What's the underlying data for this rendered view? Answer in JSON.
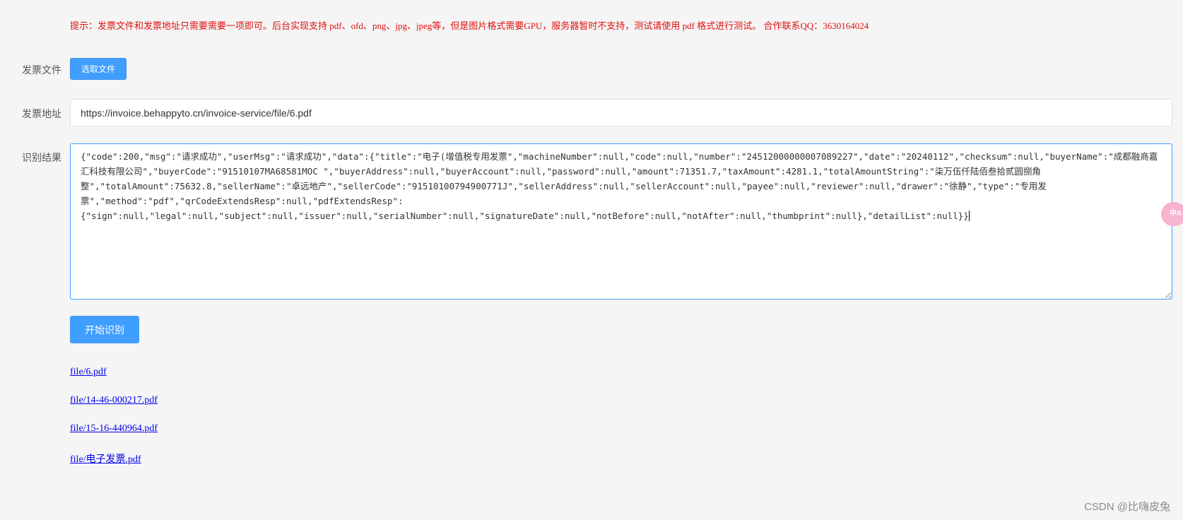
{
  "notice": "提示：发票文件和发票地址只需要需要一项即可。后台实现支持 pdf、ofd、png、jpg、jpeg等，但是图片格式需要GPU，服务器暂时不支持，测试请使用 pdf 格式进行测试。 合作联系QQ：3630164024",
  "form": {
    "file_label": "发票文件",
    "file_button": "选取文件",
    "url_label": "发票地址",
    "url_value": "https://invoice.behappyto.cn/invoice-service/file/6.pdf",
    "result_label": "识别结果",
    "result_value": "{\"code\":200,\"msg\":\"请求成功\",\"userMsg\":\"请求成功\",\"data\":{\"title\":\"电子(增值税专用发票\",\"machineNumber\":null,\"code\":null,\"number\":\"24512000000007089227\",\"date\":\"20240112\",\"checksum\":null,\"buyerName\":\"成都融商嘉汇科技有限公司\",\"buyerCode\":\"91510107MA68581MOC \",\"buyerAddress\":null,\"buyerAccount\":null,\"password\":null,\"amount\":71351.7,\"taxAmount\":4281.1,\"totalAmountString\":\"柒万伍仟陆佰叁拾贰圆捌角\n整\",\"totalAmount\":75632.8,\"sellerName\":\"卓远地产\",\"sellerCode\":\"91510100794900771J\",\"sellerAddress\":null,\"sellerAccount\":null,\"payee\":null,\"reviewer\":null,\"drawer\":\"徐静\",\"type\":\"专用发\n票\",\"method\":\"pdf\",\"qrCodeExtendsResp\":null,\"pdfExtendsResp\":\n{\"sign\":null,\"legal\":null,\"subject\":null,\"issuer\":null,\"serialNumber\":null,\"signatureDate\":null,\"notBefore\":null,\"notAfter\":null,\"thumbprint\":null},\"detailList\":null}}",
    "start_button": "开始识别"
  },
  "links": [
    "file/6.pdf",
    "file/14-46-000217.pdf",
    "file/15-16-440964.pdf",
    "file/电子发票.pdf"
  ],
  "side_bubble": "中A",
  "watermark": "CSDN @比嗨皮兔",
  "colors": {
    "primary": "#409eff",
    "notice": "#e01010",
    "link": "#0000ee",
    "background": "#f5f5f5"
  }
}
